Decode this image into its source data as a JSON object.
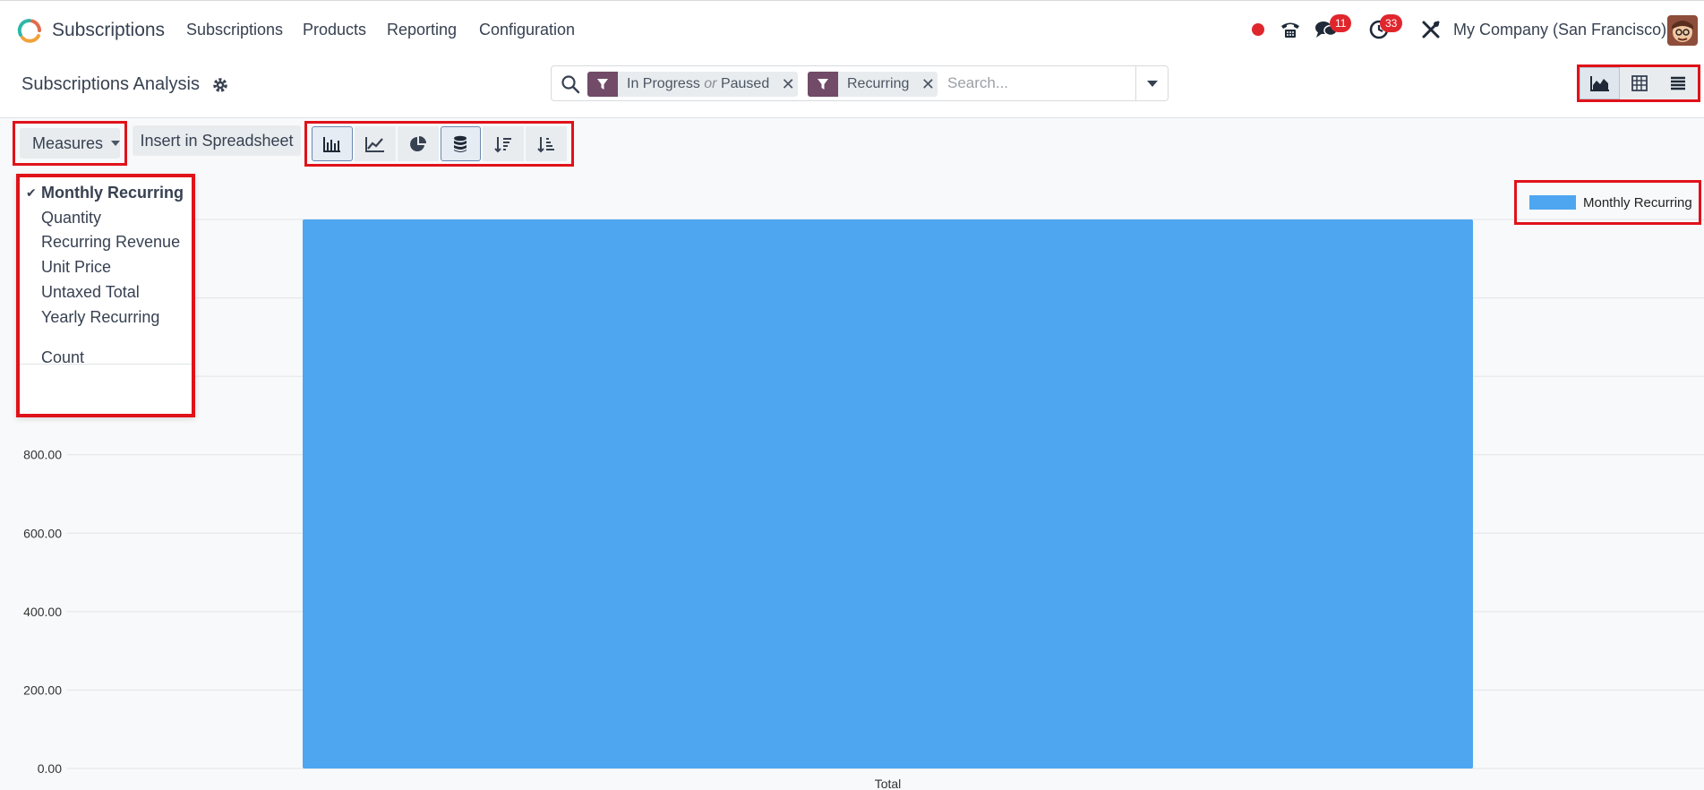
{
  "app": {
    "name": "Subscriptions",
    "nav": [
      "Subscriptions",
      "Products",
      "Reporting",
      "Configuration"
    ],
    "company": "My Company (San Francisco)",
    "messages_badge": "11",
    "activities_badge": "33"
  },
  "control": {
    "title": "Subscriptions Analysis",
    "facets": [
      {
        "value1": "In Progress",
        "sep": "or",
        "value2": "Paused"
      },
      {
        "value1": "Recurring"
      }
    ],
    "search_placeholder": "Search..."
  },
  "toolbar": {
    "measures_label": "Measures",
    "insert_label": "Insert in Spreadsheet"
  },
  "measures_menu": {
    "items": [
      "Monthly Recurring",
      "Quantity",
      "Recurring Revenue",
      "Unit Price",
      "Untaxed Total",
      "Yearly Recurring"
    ],
    "selected": "Monthly Recurring",
    "count_label": "Count"
  },
  "colors": {
    "bar": "#4fa6f0",
    "brand": "#714b67",
    "badge": "#e0262d",
    "highlight": "#e0121a"
  },
  "chart_data": {
    "type": "bar",
    "categories": [
      "Total"
    ],
    "series": [
      {
        "name": "Monthly Recurring",
        "values": [
          1400
        ]
      }
    ],
    "ylim": [
      0,
      1400
    ],
    "yticks": [
      0,
      200,
      400,
      600,
      800,
      1000,
      1200,
      1400
    ],
    "ytick_labels": [
      "0.00",
      "200.00",
      "400.00",
      "600.00",
      "800.00",
      "",
      "",
      ""
    ],
    "grid": true,
    "legend": "top-right"
  }
}
